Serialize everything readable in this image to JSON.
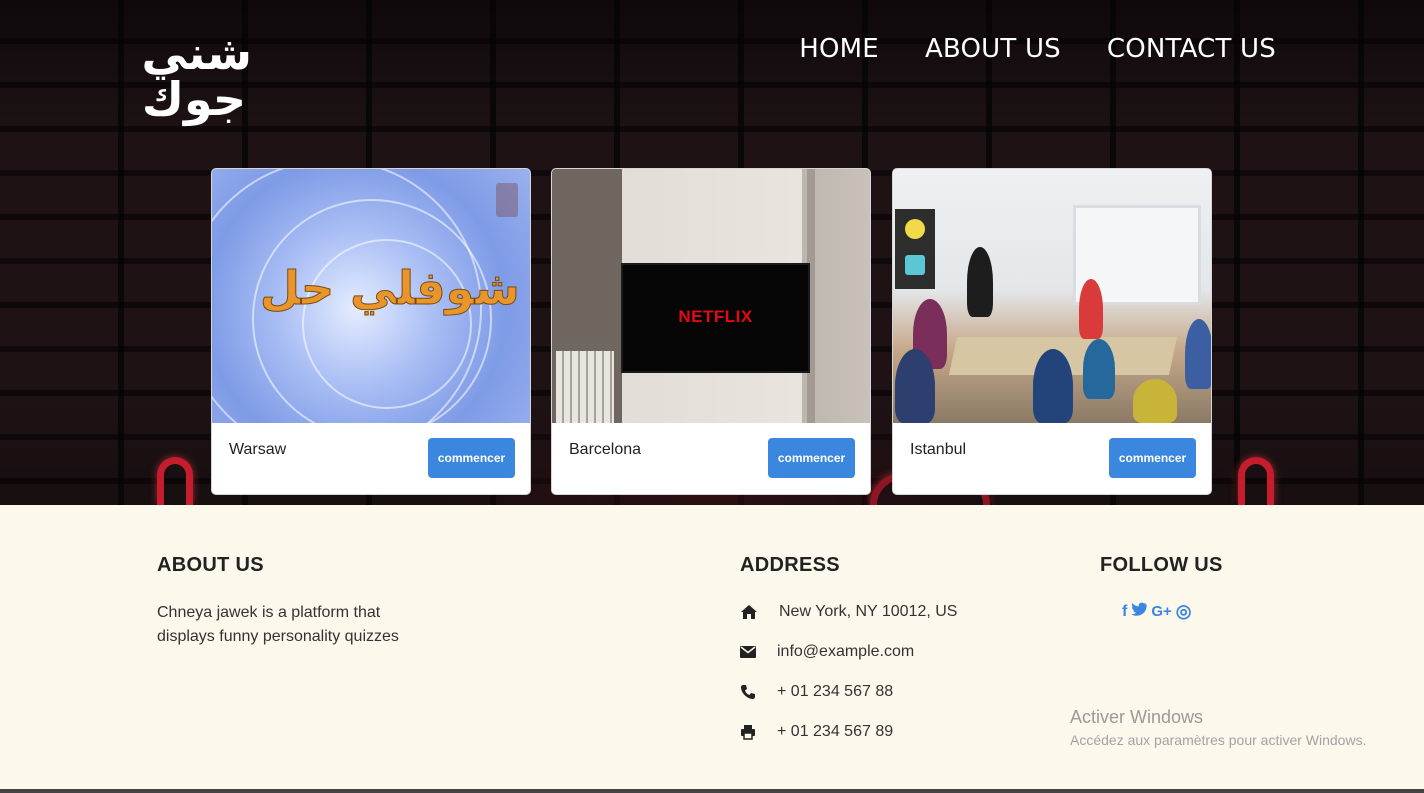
{
  "header": {
    "logo_line_1": "شني",
    "logo_line_2": "جوك",
    "nav": [
      "HOME",
      "ABOUT US",
      "CONTACT US"
    ]
  },
  "cards": [
    {
      "title": "Warsaw",
      "button_label": "commencer",
      "image_text": "شوفلي حل"
    },
    {
      "title": "Barcelona",
      "button_label": "commencer",
      "image_text": "NETFLIX"
    },
    {
      "title": "Istanbul",
      "button_label": "commencer"
    }
  ],
  "footer": {
    "about": {
      "title": "ABOUT US",
      "text": "Chneya jawek is a platform that displays funny personality quizzes"
    },
    "address": {
      "title": "ADDRESS",
      "items": [
        {
          "icon": "home-icon",
          "text": "New York, NY 10012, US"
        },
        {
          "icon": "envelope-icon",
          "text": "info@example.com"
        },
        {
          "icon": "phone-icon",
          "text": "+ 01 234 567 88"
        },
        {
          "icon": "printer-icon",
          "text": "+ 01 234 567 89"
        }
      ]
    },
    "follow": {
      "title": "FOLLOW US",
      "icons": [
        "facebook-icon",
        "twitter-icon",
        "google-plus-icon",
        "dribbble-icon"
      ],
      "glyphs": [
        "f",
        "t",
        "G+",
        "◎"
      ]
    }
  },
  "os_overlay": {
    "line_1": "Activer Windows",
    "line_2": "Accédez aux paramètres pour activer Windows."
  },
  "colors": {
    "accent": "#3b87e0",
    "footer_bg": "#fdf8ec"
  }
}
